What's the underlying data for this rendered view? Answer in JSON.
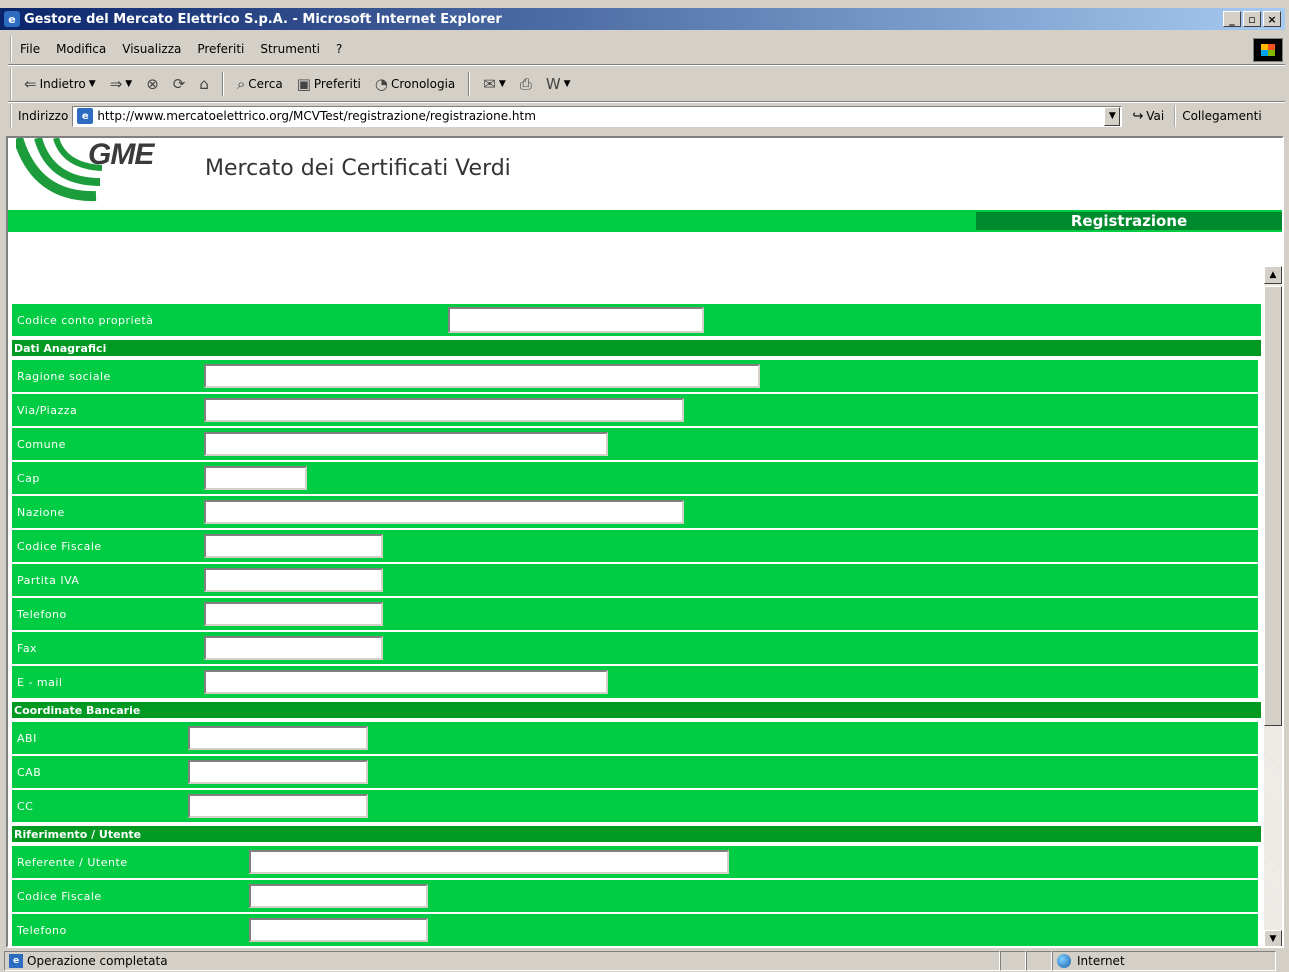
{
  "window": {
    "title": "Gestore del Mercato Elettrico S.p.A. - Microsoft Internet Explorer"
  },
  "menu": [
    "File",
    "Modifica",
    "Visualizza",
    "Preferiti",
    "Strumenti",
    "?"
  ],
  "toolbar": {
    "back": "Indietro",
    "search": "Cerca",
    "favorites": "Preferiti",
    "history": "Cronologia"
  },
  "address": {
    "label": "Indirizzo",
    "url": "http://www.mercatoelettrico.org/MCVTest/registrazione/registrazione.htm",
    "go": "Vai",
    "links": "Collegamenti"
  },
  "site": {
    "logo": "GME",
    "title": "Mercato dei Certificati Verdi",
    "section": "Registrazione"
  },
  "form": {
    "codice_conto": "Codice conto proprietà",
    "sections": {
      "anagrafici": "Dati Anagrafici",
      "bancarie": "Coordinate Bancarie",
      "riferimento": "Riferimento / Utente"
    },
    "anagrafici": [
      "Ragione sociale",
      "Via/Piazza",
      "Comune",
      "Cap",
      "Nazione",
      "Codice Fiscale",
      "Partita IVA",
      "Telefono",
      "Fax",
      "E - mail"
    ],
    "bancarie": [
      "ABI",
      "CAB",
      "CC"
    ],
    "riferimento": [
      "Referente / Utente",
      "Codice Fiscale",
      "Telefono"
    ]
  },
  "status": {
    "text": "Operazione completata",
    "zone": "Internet"
  }
}
